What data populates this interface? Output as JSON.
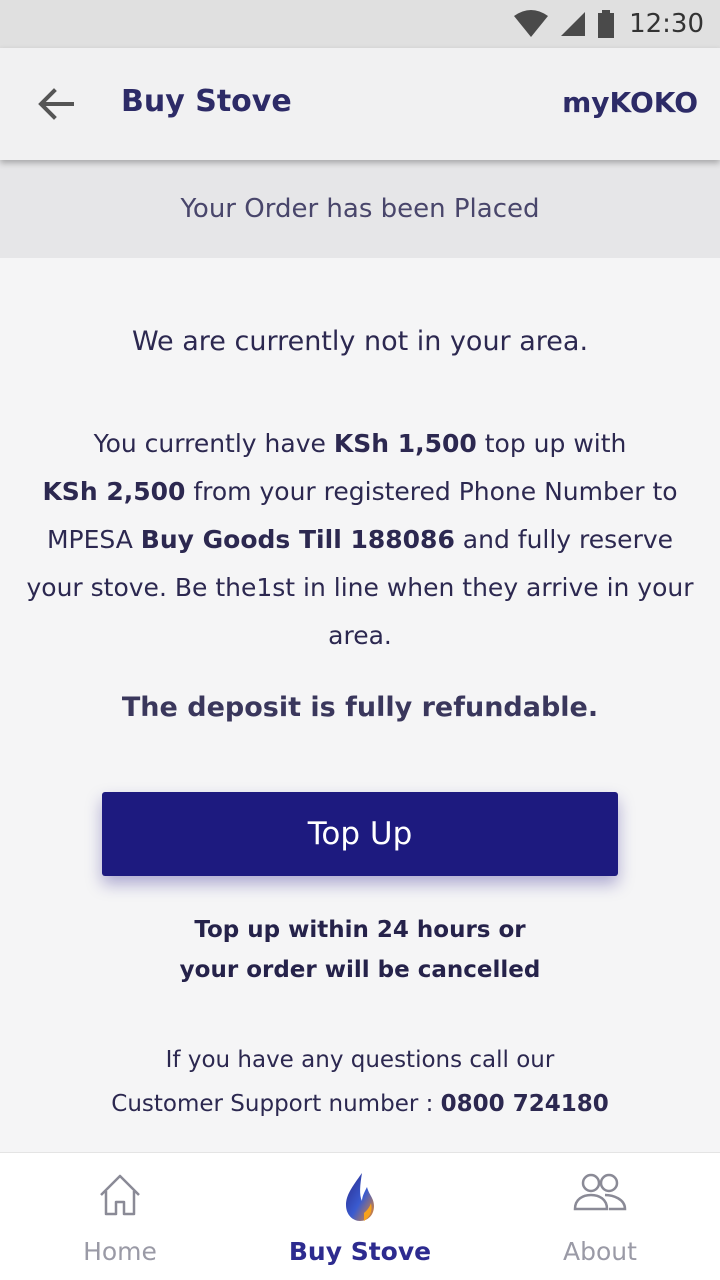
{
  "status_bar": {
    "time": "12:30"
  },
  "app_bar": {
    "title": "Buy Stove",
    "brand": "myKOKO"
  },
  "banner": {
    "text": "Your Order has been Placed"
  },
  "message": {
    "not_in_area": "We are currently not in your area.",
    "p1": "You currently have ",
    "balance": "KSh 1,500",
    "p2": " top up with ",
    "topup_amount": "KSh 2,500",
    "p3": " from your registered Phone Number to MPESA ",
    "till": "Buy Goods Till 188086",
    "p4": " and fully reserve your stove. Be the1st in line when they arrive in your area.",
    "refundable": "The deposit is fully refundable."
  },
  "topup_button": {
    "label": "Top Up"
  },
  "warning": {
    "line1": "Top up within 24 hours or",
    "line2": "your order will be cancelled"
  },
  "support": {
    "line1": "If you have any questions call our",
    "line2_prefix": "Customer Support number : ",
    "number": "0800 724180"
  },
  "bottom_nav": {
    "items": [
      {
        "label": "Home",
        "icon": "home-icon",
        "active": false
      },
      {
        "label": "Buy Stove",
        "icon": "flame-icon",
        "active": true
      },
      {
        "label": "About",
        "icon": "people-icon",
        "active": false
      }
    ]
  },
  "colors": {
    "primary": "#1d1a7f",
    "text": "#2e2a5a",
    "inactive": "#9a9aa6"
  }
}
